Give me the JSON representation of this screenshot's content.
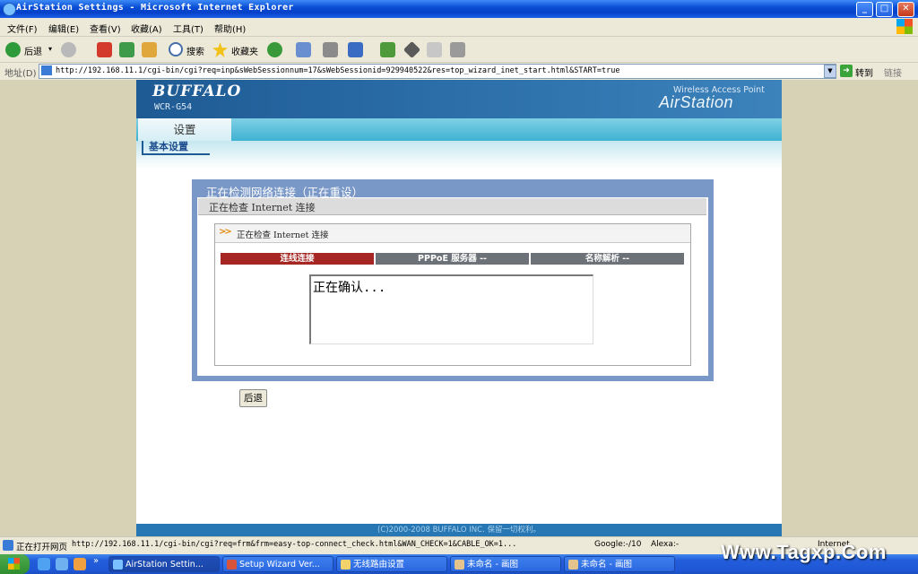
{
  "window": {
    "title": "AirStation Settings - Microsoft Internet Explorer",
    "min": "_",
    "max": "□",
    "close": "✕"
  },
  "menu": [
    "文件(F)",
    "编辑(E)",
    "查看(V)",
    "收藏(A)",
    "工具(T)",
    "帮助(H)"
  ],
  "toolbar": {
    "back": "后退",
    "search": "搜索",
    "favorites": "收藏夹"
  },
  "address": {
    "label": "地址(D)",
    "url": "http://192.168.11.1/cgi-bin/cgi?req=inp&sWebSessionnum=17&sWebSessionid=929940522&res=top_wizard_inet_start.html&START=true",
    "go": "转到",
    "links": "链接"
  },
  "header": {
    "brand": "BUFFALO",
    "model": "WCR-G54",
    "tagline": "Wireless Access Point",
    "product": "AirStation"
  },
  "nav": {
    "tab": "设置",
    "sub": "基本设置"
  },
  "wizard": {
    "title": "正在检测网络连接（正在重设）",
    "subtitle": "正在检查 Internet 连接",
    "box_title": "正在检查 Internet 连接",
    "steps": [
      "连线连接",
      "PPPoE 服务器 --",
      "名称解析 --"
    ],
    "message": "正在确认...",
    "back_button": "后退"
  },
  "footer": "(C)2000-2008 BUFFALO INC. 保留一切权利。",
  "status": {
    "text": "正在打开网页",
    "url": "http://192.168.11.1/cgi-bin/cgi?req=frm&frm=easy-top-connect_check.html&WAN_CHECK=1&CABLE_OK=1...",
    "google": "Google:-/10",
    "alexa": "Alexa:-",
    "zone": "Internet"
  },
  "taskbar": {
    "tasks": [
      "AirStation Settin...",
      "Setup Wizard  Ver...",
      "无线路由设置",
      "未命名 - 画图",
      "未命名 - 画图"
    ]
  },
  "watermark": "Www.Tagxp.Com",
  "colors": {
    "step_active": "#a52622",
    "step_inactive": "#6d7278",
    "panel_frame": "#7a98c7",
    "brand_blue": "#1e5a94"
  }
}
